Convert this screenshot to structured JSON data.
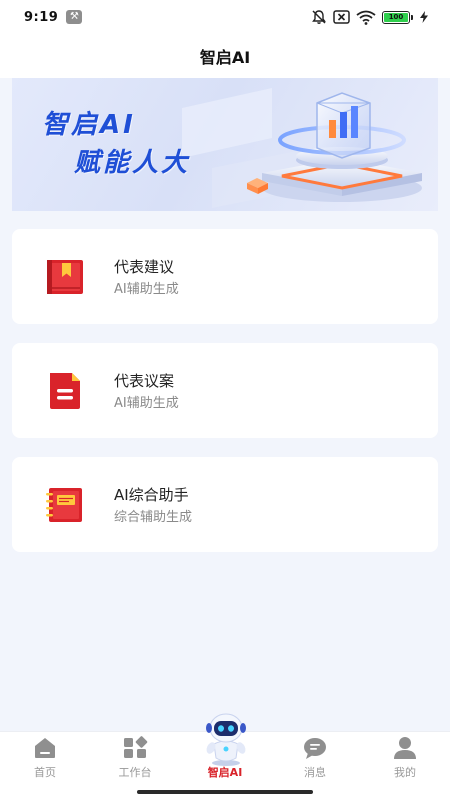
{
  "status_bar": {
    "time": "9:19",
    "battery_level": "100",
    "icons": [
      "wrench-icon",
      "mute-icon",
      "sim-off-icon",
      "wifi-icon",
      "battery-icon",
      "charging-icon"
    ]
  },
  "header": {
    "title": "智启AI"
  },
  "banner": {
    "line1": "智启AI",
    "line2": "赋能人大"
  },
  "cards": [
    {
      "title": "代表建议",
      "subtitle": "AI辅助生成",
      "icon": "bookmark-book-icon"
    },
    {
      "title": "代表议案",
      "subtitle": "AI辅助生成",
      "icon": "document-icon"
    },
    {
      "title": "AI综合助手",
      "subtitle": "综合辅助生成",
      "icon": "notebook-icon"
    }
  ],
  "tab_bar": {
    "tabs": [
      {
        "label": "首页",
        "icon": "home-icon",
        "active": false
      },
      {
        "label": "工作台",
        "icon": "grid-icon",
        "active": false
      },
      {
        "label": "智启AI",
        "icon": "robot-icon",
        "active": true
      },
      {
        "label": "消息",
        "icon": "chat-icon",
        "active": false
      },
      {
        "label": "我的",
        "icon": "user-icon",
        "active": false
      }
    ]
  },
  "colors": {
    "accent_red": "#d9232a",
    "banner_blue": "#1f4fd6",
    "background": "#f2f5fc"
  }
}
